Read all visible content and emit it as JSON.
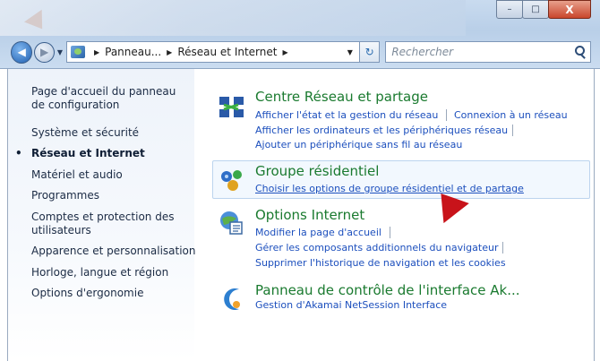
{
  "window": {
    "minimize_glyph": "–",
    "maximize_glyph": "□",
    "close_glyph": "X"
  },
  "nav": {
    "breadcrumbs": [
      "Panneau...",
      "Réseau et Internet"
    ],
    "search_placeholder": "Rechercher",
    "refresh_glyph": "↻"
  },
  "sidebar": {
    "items": [
      {
        "label": "Page d'accueil du panneau de configuration",
        "active": false
      },
      {
        "label": "Système et sécurité",
        "active": false
      },
      {
        "label": "Réseau et Internet",
        "active": true
      },
      {
        "label": "Matériel et audio",
        "active": false
      },
      {
        "label": "Programmes",
        "active": false
      },
      {
        "label": "Comptes et protection des utilisateurs",
        "active": false
      },
      {
        "label": "Apparence et personnalisation",
        "active": false
      },
      {
        "label": "Horloge, langue et région",
        "active": false
      },
      {
        "label": "Options d'ergonomie",
        "active": false
      }
    ]
  },
  "categories": [
    {
      "title": "Centre Réseau et partage",
      "icon": "network-center-icon",
      "links": [
        "Afficher l'état et la gestion du réseau",
        "Connexion à un réseau",
        "Afficher les ordinateurs et les périphériques réseau",
        "Ajouter un périphérique sans fil au réseau"
      ]
    },
    {
      "title": "Groupe résidentiel",
      "icon": "homegroup-icon",
      "links": [
        "Choisir les options de groupe résidentiel et de partage"
      ]
    },
    {
      "title": "Options Internet",
      "icon": "internet-options-icon",
      "links": [
        "Modifier la page d'accueil",
        "Gérer les composants additionnels du navigateur",
        "Supprimer l'historique de navigation et les cookies"
      ]
    },
    {
      "title": "Panneau de contrôle de l'interface Ak...",
      "icon": "akamai-icon",
      "links": [
        "Gestion d'Akamai NetSession Interface"
      ]
    }
  ],
  "colors": {
    "category_title": "#1a7a2f",
    "link": "#1c4fbd",
    "pointer_arrow": "#c8131a"
  }
}
